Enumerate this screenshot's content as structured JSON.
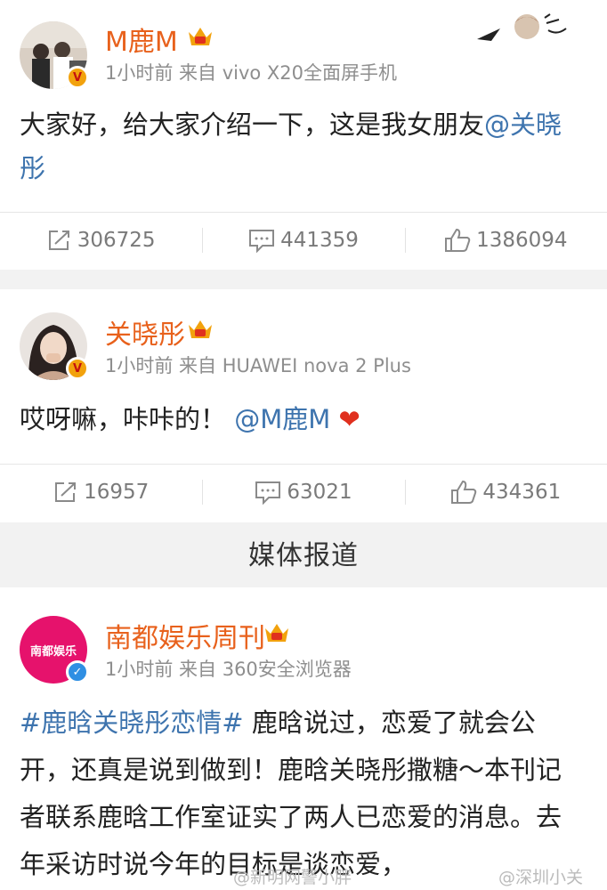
{
  "posts": [
    {
      "user": "M鹿M",
      "meta": "1小时前  来自 vivo X20全面屏手机",
      "text_plain": "大家好，给大家介绍一下，这是我女朋友",
      "text_link": "@关晓彤",
      "actions": {
        "repost": "306725",
        "comment": "441359",
        "like": "1386094"
      }
    },
    {
      "user": "关晓彤",
      "meta": "1小时前  来自 HUAWEI nova 2 Plus",
      "text_plain": "哎呀嘛，咔咔的！",
      "text_link": "@M鹿M",
      "emoji": "❤",
      "actions": {
        "repost": "16957",
        "comment": "63021",
        "like": "434361"
      }
    },
    {
      "user": "南都娱乐周刊",
      "avatar_text": "南都娱乐",
      "meta": "1小时前  来自 360安全浏览器",
      "text_link": "#鹿晗关晓彤恋情#",
      "text_plain": " 鹿晗说过，恋爱了就会公开，还真是说到做到！鹿晗关晓彤撒糖～本刊记者联系鹿晗工作室证实了两人已恋爱的消息。去年采访时说今年的目标是谈恋爱，"
    }
  ],
  "section_header": "媒体报道",
  "watermarks": [
    "@新明网警小胖",
    "@深圳小关"
  ],
  "colors": {
    "username": "#e8611c",
    "link": "#3e74ae",
    "meta": "#8e8e8e",
    "badge_gold": "#f2a20d",
    "badge_blue": "#2f8fe3"
  }
}
